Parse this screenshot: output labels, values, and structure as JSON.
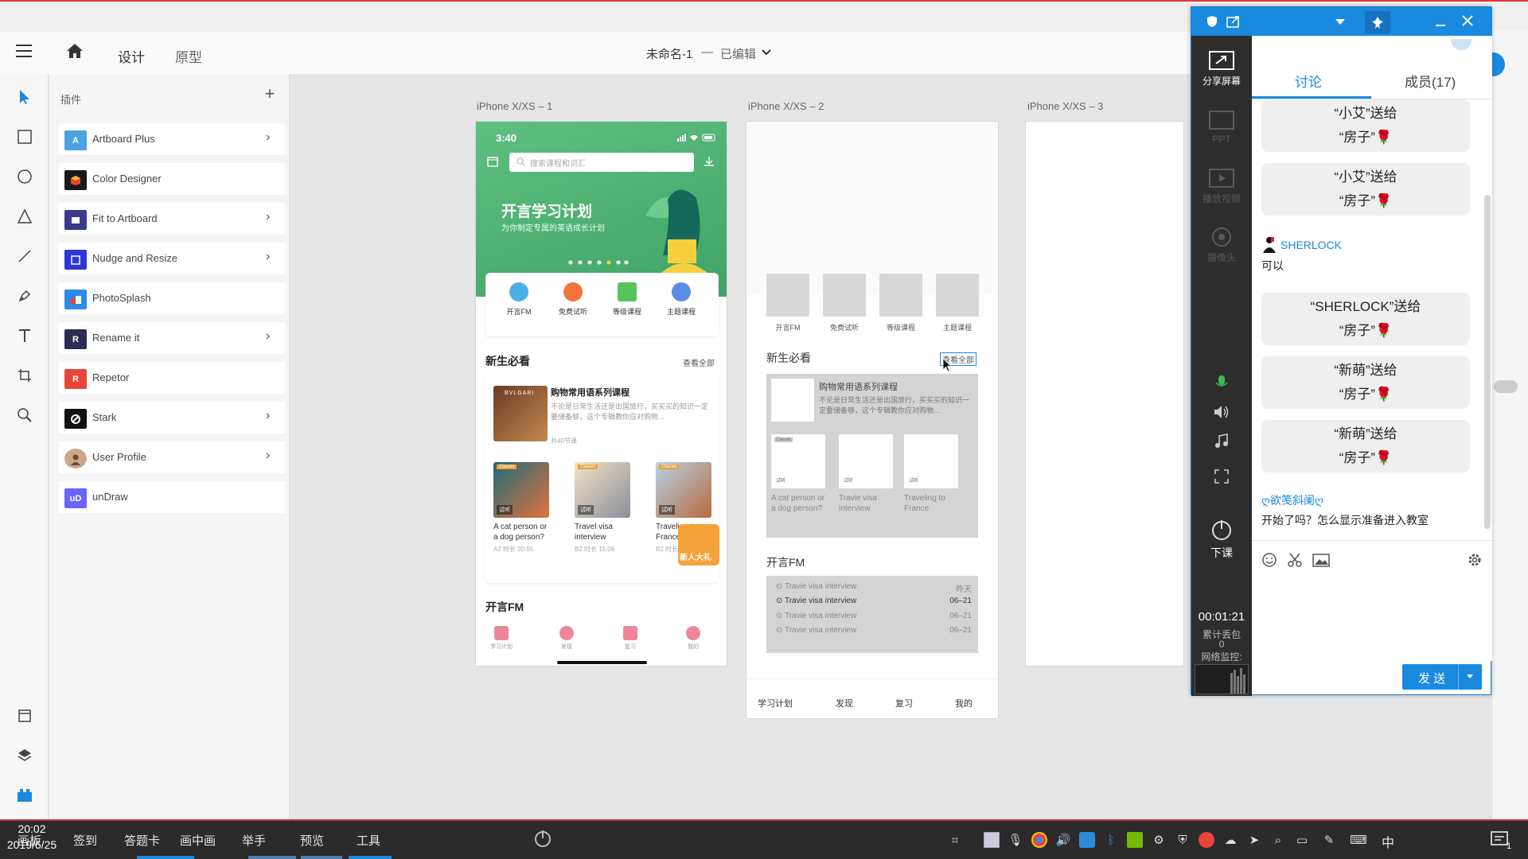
{
  "header": {
    "tabs": [
      "设计",
      "原型"
    ],
    "doc_title": "未命名-1",
    "doc_sep": "—",
    "doc_state": "已编辑"
  },
  "plugins": {
    "title": "插件",
    "items": [
      {
        "name": "Artboard Plus",
        "icon_text": "A",
        "color": "#4aa3df",
        "has_arrow": true
      },
      {
        "name": "Color Designer",
        "icon_text": "",
        "color": "#1a1a1a",
        "has_arrow": false
      },
      {
        "name": "Fit to Artboard",
        "icon_text": "",
        "color": "#3a3a8c",
        "has_arrow": true
      },
      {
        "name": "Nudge and Resize",
        "icon_text": "",
        "color": "#2f35d6",
        "has_arrow": true
      },
      {
        "name": "PhotoSplash",
        "icon_text": "",
        "color": "#2b8be6",
        "has_arrow": false
      },
      {
        "name": "Rename it",
        "icon_text": "R",
        "color": "#2c2c54",
        "has_arrow": true
      },
      {
        "name": "Repetor",
        "icon_text": "R",
        "color": "#e8443a",
        "has_arrow": false
      },
      {
        "name": "Stark",
        "icon_text": "",
        "color": "#111111",
        "has_arrow": true
      },
      {
        "name": "User Profile",
        "icon_text": "",
        "color": "#c9a98a",
        "has_arrow": true
      },
      {
        "name": "unDraw",
        "icon_text": "uD",
        "color": "#6c63ff",
        "has_arrow": false
      }
    ]
  },
  "artboards": {
    "labels": [
      "iPhone X/XS – 1",
      "iPhone X/XS – 2",
      "iPhone X/XS – 3"
    ],
    "b1": {
      "time": "3:40",
      "search_placeholder": "搜索课程和词汇",
      "hero_title": "开言学习计划",
      "hero_sub": "为你制定专属的英语成长计划",
      "categories": [
        "开言FM",
        "免费试听",
        "等级课程",
        "主题课程"
      ],
      "section1": "新生必看",
      "see_all": "查看全部",
      "course_title": "购物常用语系列课程",
      "course_desc": "不论是日常生活还是出国旅行，买买买的知识一定要储备够，这个专辑教你应对购物...",
      "course_meta": "共40节课",
      "thumb_brand": "BVLGARI",
      "minis": [
        {
          "label": "A cat person or a dog person?",
          "meta": "A2  时长 20:55",
          "tag": "Classic",
          "badge": "试听"
        },
        {
          "label": "Travel visa interview",
          "meta": "B2  时长 15:06",
          "tag": "Classic",
          "badge": "试听"
        },
        {
          "label": "Traveling to France",
          "meta": "B2  时长",
          "tag": "Classic",
          "badge": "试听"
        }
      ],
      "gift_text": "新人大礼",
      "section2": "开言FM",
      "tabs": [
        "学习计划",
        "发现",
        "复习",
        "我的"
      ]
    },
    "b2": {
      "categories": [
        "开言FM",
        "免费试听",
        "等级课程",
        "主题课程"
      ],
      "section1": "新生必看",
      "see_all": "查看全部",
      "course_title": "购物常用语系列课程",
      "course_desc": "不论是日常生活还是出国旅行，买买买的知识一定要储备够，这个专辑教你应对购物...",
      "mini_tag": "Classic",
      "mini_badge": "试听",
      "minis": [
        "A cat person or a dog person?",
        "Travie visa interview",
        "Traveling to France"
      ],
      "section2": "开言FM",
      "fm_rows": [
        {
          "title": "Travie visa interview",
          "date": "昨天"
        },
        {
          "title": "Travie visa interview",
          "date": "06–21"
        },
        {
          "title": "Travie visa interview",
          "date": "06–21"
        },
        {
          "title": "Travie visa interview",
          "date": "06–21"
        }
      ],
      "tabs": [
        "学习计划",
        "发现",
        "复习",
        "我的"
      ]
    }
  },
  "chat": {
    "side_buttons": [
      "分享屏幕",
      "PPT",
      "播放视频",
      "摄像头"
    ],
    "end_class": "下课",
    "timer": "00:01:21",
    "packet_loss_label": "累计丢包",
    "packet_loss_value": "0",
    "net_monitor": "网络监控:",
    "tabs": [
      "讨论",
      "成员(17)"
    ],
    "gifts": [
      {
        "line1": "“小艾”送给",
        "line2": "“房子”"
      },
      {
        "line1": "“小艾”送给",
        "line2": "“房子”"
      },
      {
        "line1": "“SHERLOCK”送给",
        "line2": "“房子”"
      },
      {
        "line1": "“新萌”送给",
        "line2": "“房子”"
      },
      {
        "line1": "“新萌”送给",
        "line2": "“房子”"
      }
    ],
    "user1": "SHERLOCK",
    "msg1": "可以",
    "user2": "ღ欲笺斜阑ღ",
    "msg2": "开始了吗？怎么显示准备进入教室",
    "send_label": "发 送"
  },
  "bottombar": {
    "items": [
      "画板",
      "签到",
      "答题卡",
      "画中画",
      "举手",
      "预览",
      "工具"
    ],
    "ime": "中",
    "time": "20:02",
    "date": "2019/6/25",
    "notif_count": "1"
  },
  "colors": {
    "accent": "#1a89e0",
    "brand_green": "#4caf6e",
    "rose": "#e0213f"
  }
}
